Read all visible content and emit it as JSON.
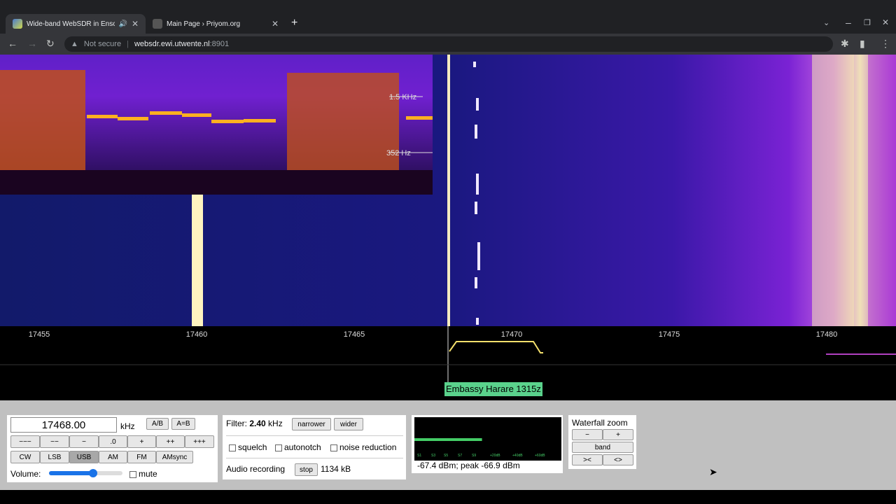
{
  "browser": {
    "tabs": [
      {
        "title": "Wide-band WebSDR in Ensch",
        "active": true
      },
      {
        "title": "Main Page › Priyom.org",
        "active": false
      }
    ],
    "url": {
      "security": "Not secure",
      "host": "websdr.ewi.utwente.nl",
      "port": ":8901"
    }
  },
  "waterfall": {
    "overlay_labels": [
      "1.5  KHz",
      "352  Hz"
    ]
  },
  "scale": {
    "ticks": [
      "17455",
      "17460",
      "17465",
      "17470",
      "17475",
      "17480"
    ],
    "station_label": "Embassy Harare 1315z"
  },
  "tuning": {
    "frequency": "17468.00",
    "unit": "kHz",
    "ab_label": "A/B",
    "aeqb_label": "A=B",
    "step_buttons": [
      "−−−",
      "−−",
      "−",
      ".0",
      "+",
      "++",
      "+++"
    ],
    "modes": [
      "CW",
      "LSB",
      "USB",
      "AM",
      "FM",
      "AMsync"
    ],
    "selected_mode": "USB",
    "volume_label": "Volume:",
    "volume_level": 0.6,
    "mute_label": "mute"
  },
  "filter": {
    "label": "Filter:",
    "value": "2.40",
    "unit": "kHz",
    "narrower": "narrower",
    "wider": "wider",
    "squelch": "squelch",
    "autonotch": "autonotch",
    "noise_reduction": "noise reduction",
    "recording_label": "Audio recording",
    "stop": "stop",
    "recording_size": "1134 kB"
  },
  "smeter": {
    "scale": [
      "S1",
      "S3",
      "S5",
      "S7",
      "S9",
      "+20dB",
      "+40dB",
      "+60dB"
    ],
    "level": 0.46,
    "reading": "-67.4 dBm; peak  -66.9 dBm"
  },
  "zoom": {
    "title": "Waterfall zoom",
    "minus": "−",
    "plus": "+",
    "band": "band",
    "narrow": "><",
    "wide": "<>"
  },
  "colors": {
    "accent_green": "#44cc66",
    "label_green": "#5ad28c"
  }
}
